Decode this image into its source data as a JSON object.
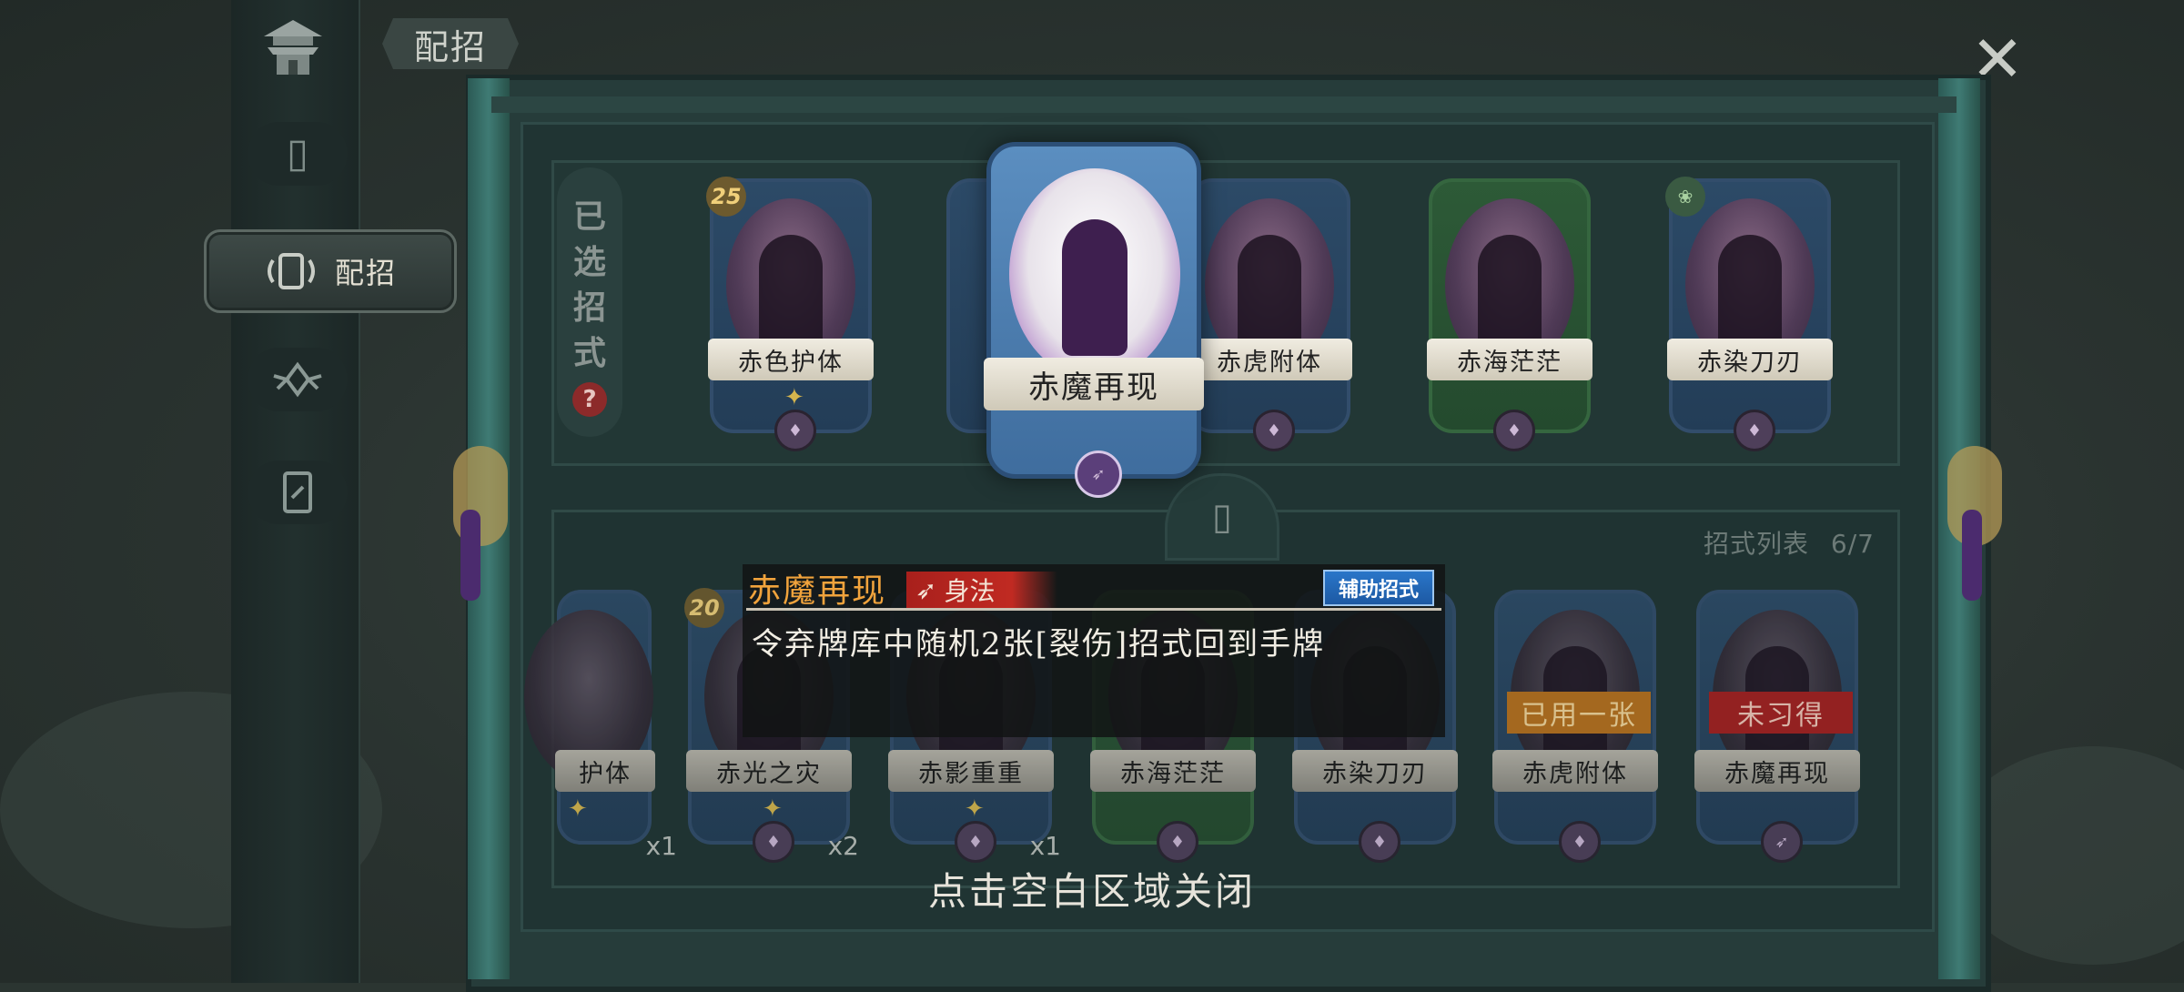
{
  "nav": {
    "page_title": "配招",
    "items": [
      {
        "name": "home",
        "icon": "pagoda-icon"
      },
      {
        "name": "cards",
        "icon": "cards-icon"
      },
      {
        "name": "loadout",
        "icon": "loadout-icon",
        "label": "配招",
        "active": true
      },
      {
        "name": "skills",
        "icon": "lotus-icon"
      },
      {
        "name": "card-box",
        "icon": "card-slot-icon"
      }
    ]
  },
  "close_icon": "close-x-icon",
  "selected": {
    "title_chars": [
      "已",
      "选",
      "招",
      "式"
    ],
    "help": "?",
    "cards": [
      {
        "name": "赤色护体",
        "cost": "25",
        "color": "blue",
        "mark": "✦"
      },
      {
        "name": "赤魔再现",
        "color": "blue",
        "featured": true
      },
      {
        "name": "赤虎附体",
        "color": "blue"
      },
      {
        "name": "赤海茫茫",
        "color": "green"
      },
      {
        "name": "赤染刀刃",
        "color": "blue"
      }
    ]
  },
  "list": {
    "count_label": "招式列表",
    "count_value": "6/7",
    "cards": [
      {
        "name": "赤色护体",
        "visible_text": "护体",
        "count": "x1",
        "mark": "✦"
      },
      {
        "name": "赤光之灾",
        "cost": "20",
        "count": "x2",
        "mark": "✦"
      },
      {
        "name": "赤影重重",
        "count": "x1",
        "mark": "✦"
      },
      {
        "name": "赤海茫茫",
        "color": "green"
      },
      {
        "name": "赤染刀刃"
      },
      {
        "name": "赤虎附体",
        "status": "已用一张",
        "status_type": "used"
      },
      {
        "name": "赤魔再现",
        "status": "未习得",
        "status_type": "unlearned"
      }
    ]
  },
  "tooltip": {
    "title": "赤魔再现",
    "type": "身法",
    "tag": "辅助招式",
    "description": "令弃牌库中随机2张[裂伤]招式回到手牌"
  },
  "hint": "点击空白区域关闭",
  "colors": {
    "background": "#2b3531",
    "board": "#263c3a",
    "card_blue": "#2c4a67",
    "card_green": "#2d5a37",
    "tooltip_title": "#f1a33c",
    "type_red": "#c02a22",
    "tag_blue": "#2a76c9",
    "status_used": "#b7701d",
    "status_unlearned": "#a31f1f"
  }
}
